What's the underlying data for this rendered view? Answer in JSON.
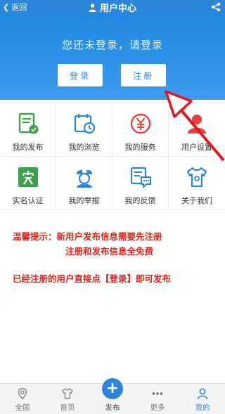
{
  "header": {
    "back_label": "返回",
    "title": "用户中心",
    "share_icon": "share-icon"
  },
  "hero": {
    "message": "您还未登录，请登录",
    "login_label": "登录",
    "register_label": "注册"
  },
  "grid": {
    "items": [
      {
        "label": "我的发布",
        "icon": "document-check-icon",
        "color": "#3aa34a"
      },
      {
        "label": "我的浏览",
        "icon": "calendar-clock-icon",
        "color": "#2b86db"
      },
      {
        "label": "我的服务",
        "icon": "yen-circle-icon",
        "color": "#e2453c"
      },
      {
        "label": "用户设置",
        "icon": "user-settings-icon",
        "color": "#e2453c"
      },
      {
        "label": "实名认证",
        "icon": "verified-badge-icon",
        "color": "#3aa34a"
      },
      {
        "label": "我的举报",
        "icon": "police-icon",
        "color": "#2b86db"
      },
      {
        "label": "我的反馈",
        "icon": "feedback-icon",
        "color": "#2b86db"
      },
      {
        "label": "关于我们",
        "icon": "tshirt-icon",
        "color": "#2b86db"
      }
    ]
  },
  "notice": {
    "line1": "温馨提示：新用户发布信息需要先注册",
    "line2": "注册和发布信息全免费",
    "line3": "已经注册的用户直接点【登录】即可发布"
  },
  "tabbar": {
    "tabs": [
      {
        "label": "全国",
        "icon": "location-icon",
        "active": false
      },
      {
        "label": "首页",
        "icon": "tshirt-icon",
        "active": false
      },
      {
        "label": "发布",
        "icon": "plus-icon",
        "active": false
      },
      {
        "label": "更多",
        "icon": "more-icon",
        "active": false
      },
      {
        "label": "我的",
        "icon": "user-icon",
        "active": true
      }
    ]
  },
  "colors": {
    "primary": "#2b86db",
    "notice_red": "#e0241c",
    "arrow_red": "#e8141b"
  }
}
